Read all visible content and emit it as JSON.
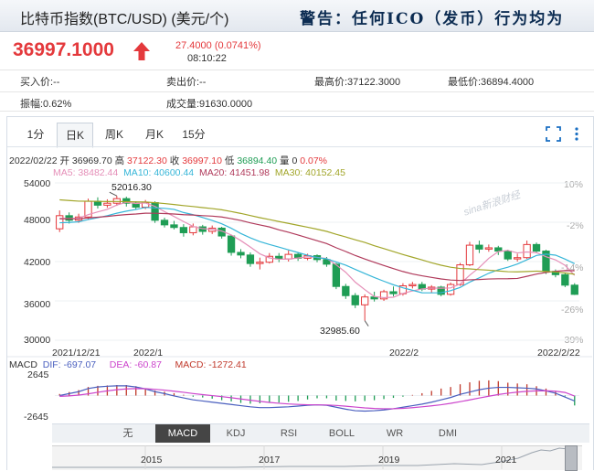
{
  "header": {
    "title": "比特币指数(BTC/USD) (美元/个)",
    "warning": "警告：任何ICO（发币）行为均为"
  },
  "quote": {
    "price": "36997.1000",
    "change": "27.4000 (0.0741%)",
    "time": "08:10:22"
  },
  "info": {
    "bid": "买入价:--",
    "ask": "卖出价:--",
    "high": "最高价:37122.3000",
    "low": "最低价:36894.4000",
    "amplitude": "振幅:0.62%",
    "volume": "成交量:91630.0000"
  },
  "tabs": [
    "1分",
    "日K",
    "周K",
    "月K",
    "15分"
  ],
  "active_tab": "日K",
  "ohlc": {
    "date": "2022/02/22",
    "open_label": "开",
    "open": "36969.70",
    "high_label": "高",
    "high": "37122.30",
    "close_label": "收",
    "close": "36997.10",
    "low_label": "低",
    "low": "36894.40",
    "volume_label": "量",
    "volume": "0",
    "pct": "0.07%"
  },
  "ma": {
    "ma5": "MA5: 38482.44",
    "ma10": "MA10: 40600.44",
    "ma20": "MA20: 41451.98",
    "ma30": "MA30: 40152.45"
  },
  "colors": {
    "up": "#e4393c",
    "down": "#1f9d55",
    "ma5": "#e58fb8",
    "ma10": "#37b6d8",
    "ma20": "#b03a5b",
    "ma30": "#a2a62a",
    "dif": "#4a5fbf",
    "dea": "#cc44cc",
    "macd": "#c0392b"
  },
  "yaxis": [
    "54000",
    "48000",
    "42000",
    "36000",
    "30000"
  ],
  "pct_axis": [
    "10%",
    "-2%",
    "-14%",
    "-26%",
    "-39%"
  ],
  "xaxis": [
    "2021/12/21",
    "2022/1",
    "2022/2",
    "2022/2/22"
  ],
  "annotations": {
    "max": "52016.30",
    "min": "32985.60"
  },
  "macd": {
    "name": "MACD",
    "dif": "DIF: -697.07",
    "dea": "DEA: -60.87",
    "macd": "MACD: -1272.41",
    "top": "2645",
    "bottom": "-2645"
  },
  "indicator_tabs": [
    "无",
    "MACD",
    "KDJ",
    "RSI",
    "BOLL",
    "WR",
    "DMI"
  ],
  "active_indicator": "MACD",
  "years": [
    "2015",
    "2017",
    "2019",
    "2021"
  ],
  "watermark": "sina新浪财经",
  "chart_data": {
    "type": "candlestick",
    "ylim": [
      30000,
      54000
    ],
    "candles": [
      {
        "o": 47000,
        "c": 49000,
        "h": 49800,
        "l": 46500
      },
      {
        "o": 49000,
        "c": 48300,
        "h": 49500,
        "l": 47800
      },
      {
        "o": 48300,
        "c": 48800,
        "h": 49300,
        "l": 47900
      },
      {
        "o": 48800,
        "c": 51200,
        "h": 51600,
        "l": 48500
      },
      {
        "o": 51200,
        "c": 50600,
        "h": 51800,
        "l": 50100
      },
      {
        "o": 50600,
        "c": 50900,
        "h": 51500,
        "l": 50200
      },
      {
        "o": 50900,
        "c": 51600,
        "h": 52016,
        "l": 50500
      },
      {
        "o": 51600,
        "c": 50900,
        "h": 51900,
        "l": 50400
      },
      {
        "o": 50900,
        "c": 50300,
        "h": 51200,
        "l": 49900
      },
      {
        "o": 50300,
        "c": 51000,
        "h": 51400,
        "l": 50000
      },
      {
        "o": 51000,
        "c": 48300,
        "h": 51200,
        "l": 47900
      },
      {
        "o": 48300,
        "c": 47600,
        "h": 48700,
        "l": 47200
      },
      {
        "o": 47600,
        "c": 47200,
        "h": 48200,
        "l": 46900
      },
      {
        "o": 47200,
        "c": 46400,
        "h": 47700,
        "l": 45800
      },
      {
        "o": 46400,
        "c": 47300,
        "h": 47800,
        "l": 46000
      },
      {
        "o": 47300,
        "c": 46600,
        "h": 47600,
        "l": 46100
      },
      {
        "o": 46600,
        "c": 47100,
        "h": 47500,
        "l": 46200
      },
      {
        "o": 47100,
        "c": 45900,
        "h": 47300,
        "l": 45500
      },
      {
        "o": 45900,
        "c": 43400,
        "h": 46100,
        "l": 42900
      },
      {
        "o": 43400,
        "c": 43000,
        "h": 43900,
        "l": 42500
      },
      {
        "o": 43000,
        "c": 41700,
        "h": 43400,
        "l": 41200
      },
      {
        "o": 41700,
        "c": 41900,
        "h": 42600,
        "l": 40800
      },
      {
        "o": 41900,
        "c": 42800,
        "h": 43300,
        "l": 41700
      },
      {
        "o": 42800,
        "c": 42400,
        "h": 43300,
        "l": 41900
      },
      {
        "o": 42400,
        "c": 43100,
        "h": 43700,
        "l": 42000
      },
      {
        "o": 43100,
        "c": 42500,
        "h": 43400,
        "l": 42100
      },
      {
        "o": 42500,
        "c": 42900,
        "h": 43200,
        "l": 42200
      },
      {
        "o": 42900,
        "c": 42300,
        "h": 43100,
        "l": 41900
      },
      {
        "o": 42300,
        "c": 41600,
        "h": 42700,
        "l": 41200
      },
      {
        "o": 41600,
        "c": 38200,
        "h": 41800,
        "l": 37800
      },
      {
        "o": 38200,
        "c": 36800,
        "h": 38600,
        "l": 36300
      },
      {
        "o": 36800,
        "c": 35400,
        "h": 37200,
        "l": 34900
      },
      {
        "o": 35400,
        "c": 36600,
        "h": 37000,
        "l": 32986
      },
      {
        "o": 36600,
        "c": 36300,
        "h": 37400,
        "l": 35900
      },
      {
        "o": 36300,
        "c": 37400,
        "h": 37700,
        "l": 36000
      },
      {
        "o": 37400,
        "c": 37100,
        "h": 38200,
        "l": 36700
      },
      {
        "o": 37100,
        "c": 38300,
        "h": 38700,
        "l": 36800
      },
      {
        "o": 38300,
        "c": 38500,
        "h": 38900,
        "l": 37900
      },
      {
        "o": 38500,
        "c": 37800,
        "h": 38900,
        "l": 37500
      },
      {
        "o": 37800,
        "c": 38100,
        "h": 38400,
        "l": 37200
      },
      {
        "o": 38100,
        "c": 37000,
        "h": 38300,
        "l": 36700
      },
      {
        "o": 37000,
        "c": 38500,
        "h": 38800,
        "l": 36800
      },
      {
        "o": 38500,
        "c": 41500,
        "h": 41800,
        "l": 38300
      },
      {
        "o": 41500,
        "c": 44500,
        "h": 45000,
        "l": 41300
      },
      {
        "o": 44500,
        "c": 43900,
        "h": 45200,
        "l": 43300
      },
      {
        "o": 43900,
        "c": 44100,
        "h": 44600,
        "l": 43500
      },
      {
        "o": 44100,
        "c": 43600,
        "h": 44400,
        "l": 43000
      },
      {
        "o": 43600,
        "c": 42400,
        "h": 43800,
        "l": 42100
      },
      {
        "o": 42400,
        "c": 42600,
        "h": 43200,
        "l": 42000
      },
      {
        "o": 42600,
        "c": 44600,
        "h": 45200,
        "l": 42400
      },
      {
        "o": 44600,
        "c": 43600,
        "h": 44900,
        "l": 43300
      },
      {
        "o": 43600,
        "c": 40500,
        "h": 43800,
        "l": 40100
      },
      {
        "o": 40500,
        "c": 40000,
        "h": 40800,
        "l": 39600
      },
      {
        "o": 40000,
        "c": 38400,
        "h": 40300,
        "l": 38100
      },
      {
        "o": 38400,
        "c": 36997,
        "h": 38700,
        "l": 36900
      }
    ],
    "macd": {
      "range": [
        -2645,
        2645
      ],
      "hist": [
        200,
        450,
        700,
        1100,
        1250,
        1300,
        1350,
        1350,
        1200,
        900,
        650,
        500,
        300,
        100,
        -150,
        -250,
        -400,
        -600,
        -750,
        -950,
        -1050,
        -1000,
        -950,
        -900,
        -800,
        -700,
        -500,
        -350,
        -350,
        -650,
        -700,
        -750,
        -700,
        -600,
        -450,
        -300,
        -150,
        80,
        300,
        600,
        900,
        1100,
        1450,
        1700,
        1900,
        1950,
        1850,
        1650,
        1550,
        1450,
        1200,
        900,
        500,
        -100,
        -1272
      ],
      "dif": [
        0,
        250,
        500,
        900,
        1100,
        1200,
        1250,
        1250,
        1100,
        850,
        500,
        250,
        -50,
        -300,
        -550,
        -700,
        -850,
        -1000,
        -1150,
        -1300,
        -1450,
        -1550,
        -1550,
        -1500,
        -1450,
        -1350,
        -1250,
        -1200,
        -1250,
        -1500,
        -1750,
        -1950,
        -2000,
        -1950,
        -1850,
        -1700,
        -1500,
        -1300,
        -1100,
        -850,
        -550,
        -250,
        150,
        450,
        750,
        950,
        1050,
        1050,
        1000,
        950,
        850,
        600,
        300,
        -200,
        -697
      ],
      "dea": [
        -100,
        -40,
        60,
        220,
        420,
        600,
        750,
        850,
        900,
        880,
        800,
        700,
        560,
        420,
        260,
        120,
        -10,
        -140,
        -280,
        -440,
        -600,
        -750,
        -880,
        -990,
        -1080,
        -1140,
        -1180,
        -1200,
        -1210,
        -1270,
        -1370,
        -1480,
        -1590,
        -1660,
        -1700,
        -1690,
        -1650,
        -1560,
        -1450,
        -1320,
        -1180,
        -1000,
        -790,
        -560,
        -320,
        -90,
        130,
        300,
        440,
        540,
        600,
        620,
        560,
        400,
        -61
      ]
    }
  }
}
